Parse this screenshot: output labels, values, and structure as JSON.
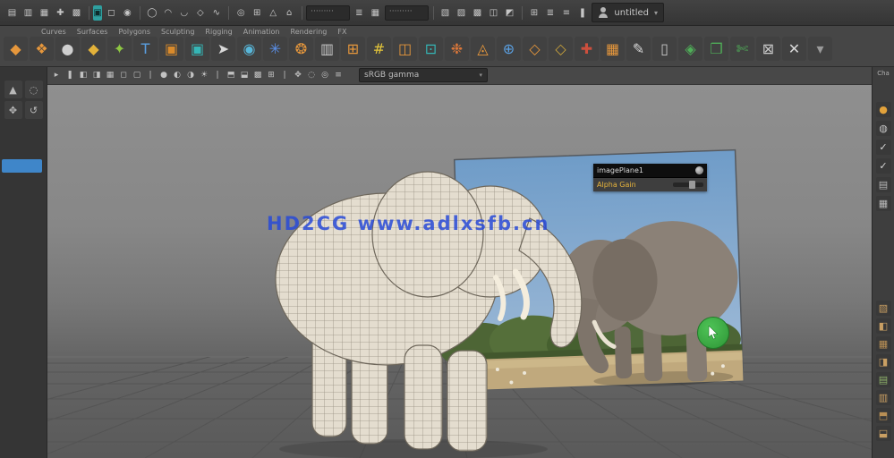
{
  "menubar": {
    "file_icons": [
      "▤",
      "▥",
      "▦",
      "✚",
      "▩"
    ],
    "active_icon": "▣",
    "mode_icons": [
      "◻",
      "◉"
    ],
    "curve_icons": [
      "◯",
      "◠",
      "◡",
      "◇",
      "∿"
    ],
    "snap_icons": [
      "◎",
      "⊞",
      "△",
      "⌂"
    ],
    "field1": "·········",
    "mid_icons": [
      "≣",
      "▦"
    ],
    "field2": "·········",
    "render_icons": [
      "▧",
      "▨",
      "▩",
      "◫",
      "◩"
    ],
    "right_icons": [
      "⊞",
      "≣",
      "≡",
      "❚"
    ],
    "user": {
      "label": "untitled",
      "chevron": "▾"
    }
  },
  "shelf": {
    "tabs": [
      "Curves",
      "Surfaces",
      "Polygons",
      "Sculpting",
      "Rigging",
      "Animation",
      "Rendering",
      "FX"
    ],
    "icons": [
      {
        "g": "◆",
        "c": "#e6973c"
      },
      {
        "g": "❖",
        "c": "#e6973c"
      },
      {
        "g": "●",
        "c": "#cfcfcf"
      },
      {
        "g": "◆",
        "c": "#e3b23a"
      },
      {
        "g": "✦",
        "c": "#8ec742"
      },
      {
        "g": "T",
        "c": "#5a9fe0"
      },
      {
        "g": "▣",
        "c": "#d98a2b"
      },
      {
        "g": "▣",
        "c": "#35b6b6"
      },
      {
        "g": "➤",
        "c": "#d8d8d8"
      },
      {
        "g": "◉",
        "c": "#58b6d8"
      },
      {
        "g": "✳",
        "c": "#5a8fe8"
      },
      {
        "g": "❂",
        "c": "#e6973c"
      },
      {
        "g": "▥",
        "c": "#c9c9c9"
      },
      {
        "g": "⊞",
        "c": "#e6973c"
      },
      {
        "g": "#",
        "c": "#e3c53a"
      },
      {
        "g": "◫",
        "c": "#e6973c"
      },
      {
        "g": "⊡",
        "c": "#35b6b6"
      },
      {
        "g": "❉",
        "c": "#d8763a"
      },
      {
        "g": "◬",
        "c": "#e6973c"
      },
      {
        "g": "⊕",
        "c": "#5a9fe0"
      },
      {
        "g": "◇",
        "c": "#e6973c"
      },
      {
        "g": "◇",
        "c": "#c9a23c"
      },
      {
        "g": "✚",
        "c": "#cc4f3d"
      },
      {
        "g": "▦",
        "c": "#e6973c"
      },
      {
        "g": "✎",
        "c": "#d8d8d8"
      },
      {
        "g": "▯",
        "c": "#c9c9c9"
      },
      {
        "g": "◈",
        "c": "#4fae58"
      },
      {
        "g": "❒",
        "c": "#4fae58"
      },
      {
        "g": "✄",
        "c": "#4fae58"
      },
      {
        "g": "⊠",
        "c": "#c9c9c9"
      },
      {
        "g": "✕",
        "c": "#d8d8d8"
      },
      {
        "g": "▾",
        "c": "#9a9a9a"
      }
    ]
  },
  "toolbox": {
    "tools": [
      "▲",
      "◌",
      "✥",
      "↺"
    ]
  },
  "viewport_toolbar": {
    "icons": [
      "▸",
      "❚",
      "◧",
      "◨",
      "▦",
      "◻",
      "▢",
      "|",
      "●",
      "◐",
      "◑",
      "☀",
      "|",
      "⬒",
      "⬓",
      "▩",
      "⊞",
      "|",
      "✥",
      "◌",
      "◎",
      "≡"
    ],
    "combo": {
      "value": "sRGB gamma",
      "chevron": "▾"
    }
  },
  "hud": {
    "title": "imagePlane1",
    "attr_label": "Alpha Gain"
  },
  "right_bar": {
    "tab_label": "Cha",
    "top_icons": [
      {
        "g": "●",
        "c": "#e2a23b"
      },
      {
        "g": "◍",
        "c": "#c4c4c4"
      },
      {
        "g": "✓",
        "c": "#d8d8d8"
      },
      {
        "g": "✓",
        "c": "#d8d8d8"
      },
      {
        "g": "▤",
        "c": "#b8b8b8"
      },
      {
        "g": "▦",
        "c": "#b8b8b8"
      }
    ],
    "bottom_icons": [
      {
        "g": "▧",
        "c": "#c99f63"
      },
      {
        "g": "◧",
        "c": "#c99f63"
      },
      {
        "g": "▦",
        "c": "#b98f55"
      },
      {
        "g": "◨",
        "c": "#c99f63"
      },
      {
        "g": "▤",
        "c": "#8fb36a"
      },
      {
        "g": "▥",
        "c": "#c99f63"
      },
      {
        "g": "⬒",
        "c": "#b98f55"
      },
      {
        "g": "⬓",
        "c": "#c99f63"
      }
    ]
  },
  "watermark": {
    "text": "HD2CG www.adlxsfb.cn"
  },
  "colors": {
    "accent_blue": "#3f86c9",
    "shelf_highlight_teal": "#2fa0a0",
    "viewport_top": "#8f8f8f",
    "viewport_bottom": "#5a5a5a",
    "grid_line": "#545454",
    "photo_sky": "#7ba3cc",
    "photo_sand": "#c0a97d",
    "photo_tree": "#4d6535",
    "photo_elephant": "#8b8177",
    "wire_fill": "#e4ddcf",
    "wire_line": "#978f81",
    "cursor_green": "#3aa83f",
    "watermark_blue": "#284ad7"
  }
}
